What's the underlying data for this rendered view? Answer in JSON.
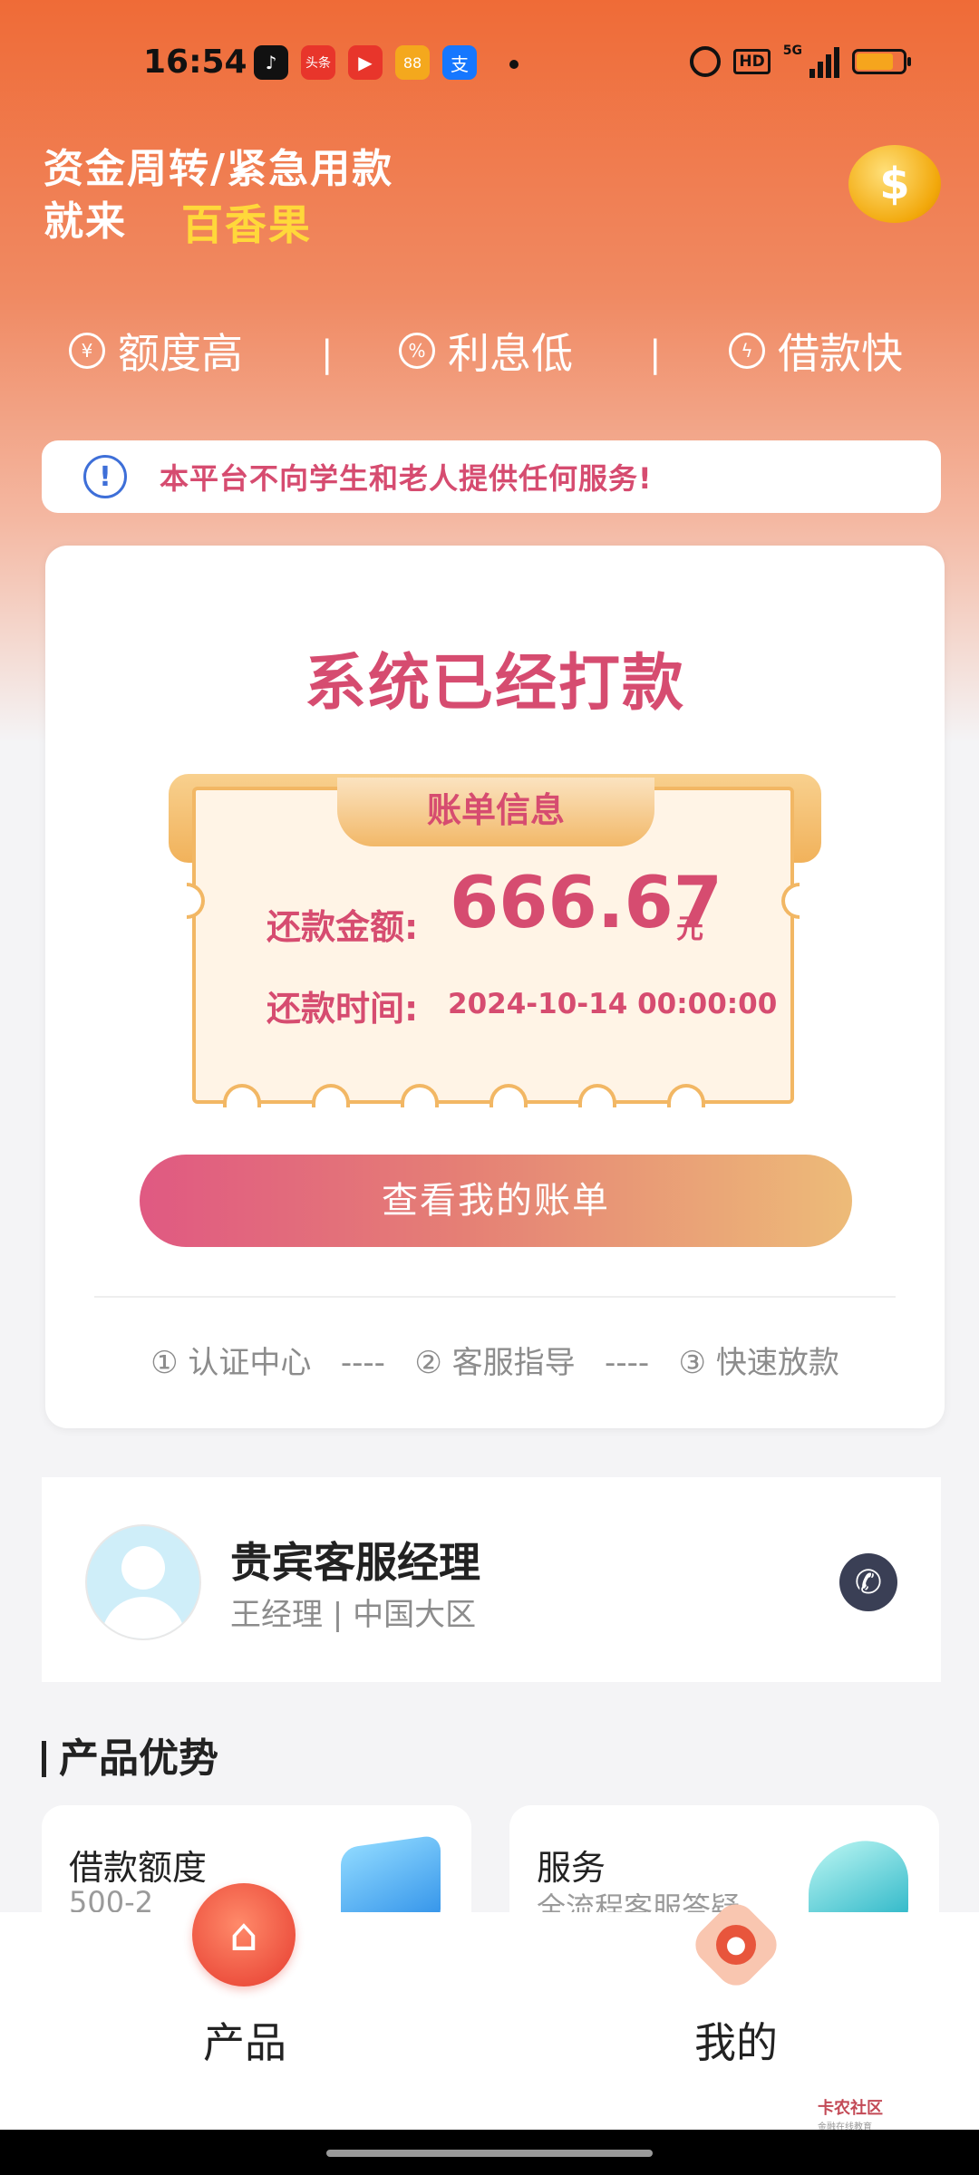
{
  "status_bar": {
    "time": "16:54",
    "apps": [
      {
        "icon": "douyin-icon",
        "color": "#111111",
        "glyph": "♪"
      },
      {
        "icon": "toutiao-icon",
        "color": "#e8352b",
        "glyph": "头条"
      },
      {
        "icon": "video-icon",
        "color": "#e8352b",
        "glyph": "▶"
      },
      {
        "icon": "game-icon",
        "color": "#f4a81d",
        "glyph": "88"
      },
      {
        "icon": "alipay-icon",
        "color": "#1677ff",
        "glyph": "支"
      }
    ],
    "hd": "HD",
    "network": "5G",
    "battery_level": 0.8
  },
  "header": {
    "line1": "资金周转/紧急用款",
    "line2": "就来",
    "brand": "百香果",
    "coin_icon": "coin-icon",
    "coin_glyph": "$"
  },
  "features": [
    {
      "label": "额度高",
      "icon": "money-bag-icon",
      "glyph": "¥"
    },
    {
      "label": "利息低",
      "icon": "percent-icon",
      "glyph": "%"
    },
    {
      "label": "借款快",
      "icon": "lightning-icon",
      "glyph": "ϟ"
    }
  ],
  "feature_separator": "|",
  "notice": {
    "icon": "info-icon",
    "glyph": "!",
    "text": "本平台不向学生和老人提供任何服务!"
  },
  "main_card": {
    "title": "系统已经打款",
    "bill_tab": "账单信息",
    "amount_label": "还款金额:",
    "amount_value": "666.67",
    "amount_unit": "元",
    "time_label": "还款时间:",
    "time_value": "2024-10-14 00:00:00",
    "button": "查看我的账单",
    "steps": "① 认证中心   ----   ② 客服指导   ----   ③ 快速放款"
  },
  "manager": {
    "title": "贵宾客服经理",
    "subtitle": "王经理 | 中国大区",
    "phone_icon": "phone-icon",
    "phone_glyph": "✆"
  },
  "products": {
    "section_title": "产品优势",
    "items": [
      {
        "title": "借款额度",
        "subtitle": "500-2"
      },
      {
        "title": "服务",
        "subtitle": "全流程客服答疑"
      }
    ]
  },
  "tabbar": {
    "tabs": [
      {
        "label": "产品",
        "icon": "home-icon",
        "glyph": "⌂"
      },
      {
        "label": "我的",
        "icon": "user-icon",
        "glyph": "●"
      }
    ]
  },
  "watermark": {
    "title": "卡农社区",
    "subtitle": "金融在线教育"
  }
}
